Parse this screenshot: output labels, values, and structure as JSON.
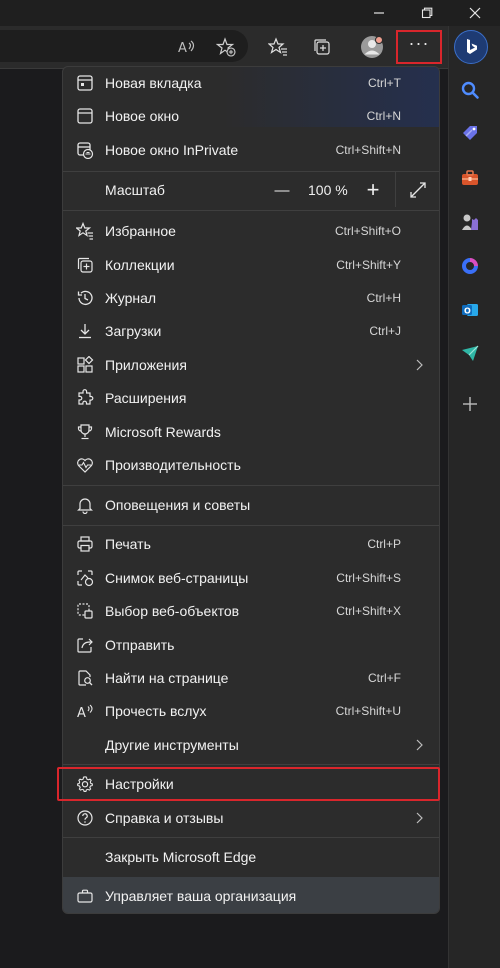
{
  "menu": {
    "new_tab": {
      "label": "Новая вкладка",
      "shortcut": "Ctrl+T"
    },
    "new_window": {
      "label": "Новое окно",
      "shortcut": "Ctrl+N"
    },
    "new_inprivate": {
      "label": "Новое окно InPrivate",
      "shortcut": "Ctrl+Shift+N"
    },
    "zoom": {
      "label": "Масштаб",
      "minus": "—",
      "value": "100 %",
      "plus": "+"
    },
    "favorites": {
      "label": "Избранное",
      "shortcut": "Ctrl+Shift+O"
    },
    "collections": {
      "label": "Коллекции",
      "shortcut": "Ctrl+Shift+Y"
    },
    "history": {
      "label": "Журнал",
      "shortcut": "Ctrl+H"
    },
    "downloads": {
      "label": "Загрузки",
      "shortcut": "Ctrl+J"
    },
    "apps": {
      "label": "Приложения"
    },
    "extensions": {
      "label": "Расширения"
    },
    "rewards": {
      "label": "Microsoft Rewards"
    },
    "performance": {
      "label": "Производительность"
    },
    "alerts": {
      "label": "Оповещения и советы"
    },
    "print": {
      "label": "Печать",
      "shortcut": "Ctrl+P"
    },
    "screenshot": {
      "label": "Снимок веб-страницы",
      "shortcut": "Ctrl+Shift+S"
    },
    "web_select": {
      "label": "Выбор веб-объектов",
      "shortcut": "Ctrl+Shift+X"
    },
    "share": {
      "label": "Отправить"
    },
    "find": {
      "label": "Найти на странице",
      "shortcut": "Ctrl+F"
    },
    "read_aloud": {
      "label": "Прочесть вслух",
      "shortcut": "Ctrl+Shift+U"
    },
    "more_tools": {
      "label": "Другие инструменты"
    },
    "settings": {
      "label": "Настройки"
    },
    "help": {
      "label": "Справка и отзывы"
    },
    "close_edge": {
      "label": "Закрыть Microsoft Edge"
    },
    "managed": {
      "label": "Управляет ваша организация"
    }
  },
  "toolbar": {
    "more_label": "···"
  },
  "colors": {
    "highlight": "#d9262c",
    "menu_bg": "#2c2c2c",
    "accent": "#4f8cff"
  },
  "icons": [
    "minimize-icon",
    "maximize-icon",
    "close-icon",
    "read-aloud-icon",
    "add-favorite-icon",
    "favorites-icon",
    "collections-icon",
    "profile-icon",
    "more-icon",
    "bing-icon",
    "search-icon",
    "shopping-icon",
    "tools-icon",
    "games-icon",
    "office-icon",
    "outlook-icon",
    "drop-icon",
    "add-icon"
  ]
}
